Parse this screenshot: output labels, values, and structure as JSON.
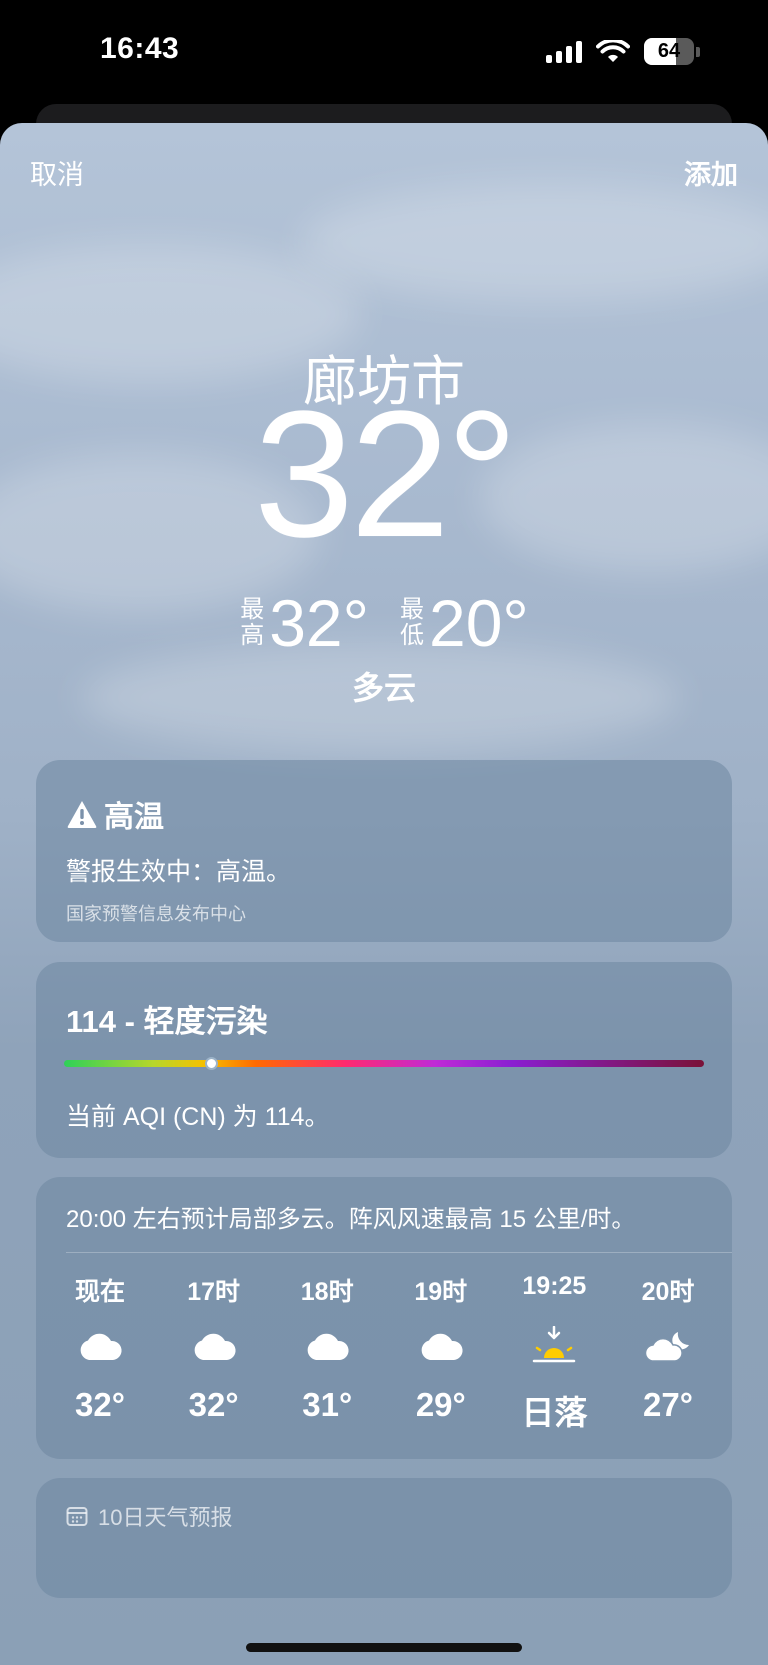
{
  "status_bar": {
    "time": "16:43",
    "battery": "64",
    "battery_fraction": 0.64
  },
  "nav": {
    "cancel_label": "取消",
    "add_label": "添加"
  },
  "current": {
    "city": "廊坊市",
    "temperature": "32°",
    "high_label": "最高",
    "high": "32°",
    "low_label": "最低",
    "low": "20°",
    "condition": "多云"
  },
  "alert": {
    "icon": "warning-icon",
    "title": "高温",
    "description": "警报生效中：高温。",
    "source": "国家预警信息发布中心"
  },
  "aqi": {
    "title": "114 - 轻度污染",
    "value": 114,
    "bar_position": 0.23,
    "description": "当前 AQI (CN) 为 114。"
  },
  "hourly": {
    "summary": "20:00 左右预计局部多云。阵风风速最高 15 公里/时。",
    "items": [
      {
        "label": "现在",
        "icon": "cloud-icon",
        "temp": "32°"
      },
      {
        "label": "17时",
        "icon": "cloud-icon",
        "temp": "32°"
      },
      {
        "label": "18时",
        "icon": "cloud-icon",
        "temp": "31°"
      },
      {
        "label": "19时",
        "icon": "cloud-icon",
        "temp": "29°"
      },
      {
        "label": "19:25",
        "icon": "sunset-icon",
        "temp": "日落"
      },
      {
        "label": "20时",
        "icon": "cloud-moon-icon",
        "temp": "27°"
      }
    ]
  },
  "ten_day": {
    "icon": "calendar-icon",
    "title": "10日天气预报"
  },
  "colors": {
    "sky_top": "#b4c4d8",
    "sky_bottom": "#8ba0b6",
    "sun": "#ffcc00"
  }
}
